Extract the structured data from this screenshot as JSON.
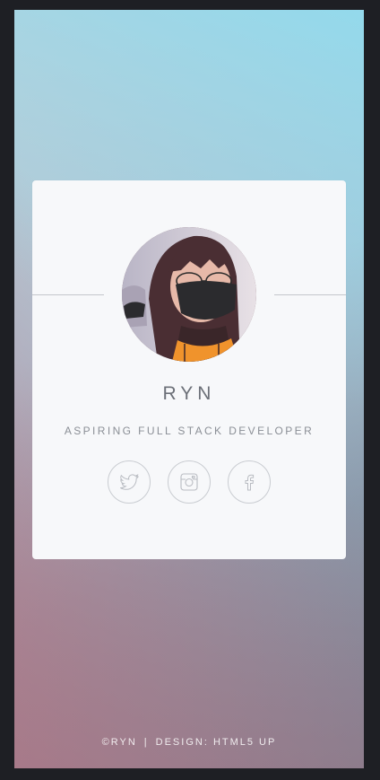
{
  "profile": {
    "name": "RYN",
    "tagline": "ASPIRING FULL STACK DEVELOPER",
    "avatar_alt": ""
  },
  "socials": [
    {
      "icon": "twitter-icon"
    },
    {
      "icon": "instagram-icon"
    },
    {
      "icon": "facebook-icon"
    }
  ],
  "footer": {
    "copyright": "©RYN",
    "separator": "|",
    "design_label": "DESIGN:",
    "design_link": "HTML5 UP"
  },
  "colors": {
    "card": "#f7f8fa",
    "text": "#6c7078",
    "border": "#c9ccd1",
    "gradient_top": "#8cdcf0",
    "gradient_bottom_left": "#c47f8c"
  }
}
